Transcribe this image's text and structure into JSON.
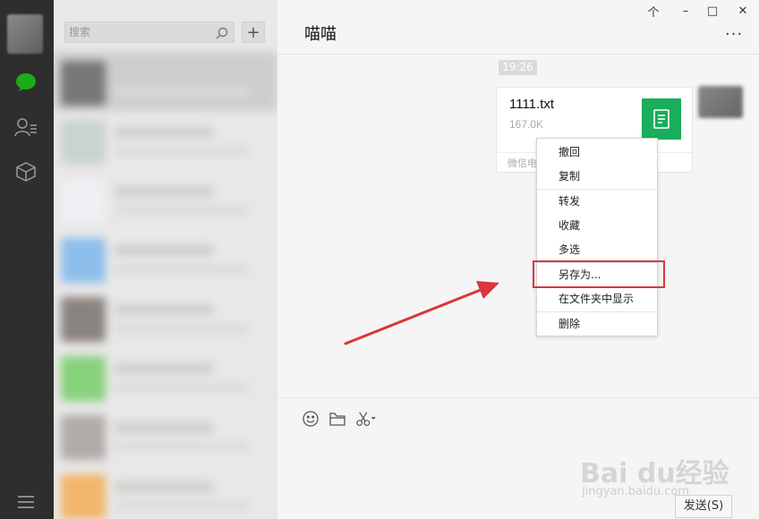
{
  "window": {
    "controls": {
      "pin": "个",
      "minimize": "–",
      "maximize": "□",
      "close": "✕"
    }
  },
  "sidebar": {
    "icons": [
      "chat-icon",
      "contacts-icon",
      "favorites-icon"
    ],
    "menu_icon": "menu-icon",
    "accent": "#1aad19"
  },
  "search": {
    "placeholder": "搜索",
    "add_label": "+"
  },
  "chat": {
    "title": "喵喵",
    "more_label": "···",
    "time": "19:26",
    "file": {
      "name": "1111.txt",
      "size": "167.0K",
      "source": "微信电",
      "icon_color": "#1aad5b"
    }
  },
  "context_menu": {
    "items": [
      "撤回",
      "复制",
      "转发",
      "收藏",
      "多选",
      "另存为...",
      "在文件夹中显示",
      "删除"
    ],
    "highlighted": "另存为...",
    "highlight_color": "#d9363e"
  },
  "input_area": {
    "tools": [
      "emoji-icon",
      "folder-icon",
      "scissors-icon"
    ],
    "send_label": "发送(S)"
  },
  "watermark": {
    "brand": "Bai du经验",
    "url": "jingyan.baidu.com"
  }
}
